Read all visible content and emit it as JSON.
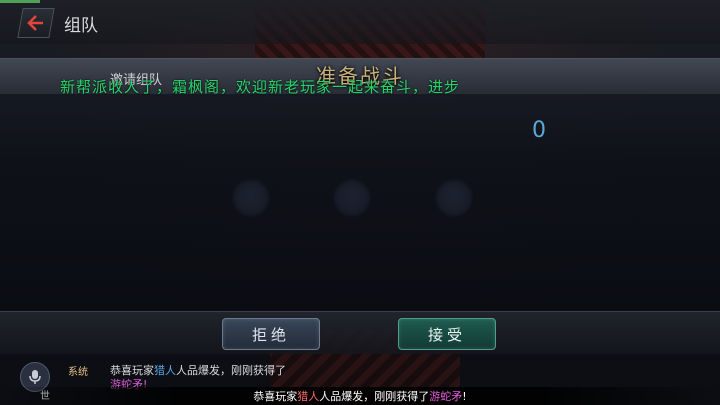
{
  "header": {
    "title": "组队"
  },
  "dialog": {
    "title": "准备战斗",
    "invite_label": "邀请组队",
    "countdown": "0",
    "marquee": "新帮派收人了，霜枫阁，欢迎新老玩家一起来奋斗，进步",
    "refuse_label": "拒绝",
    "accept_label": "接受"
  },
  "chat": {
    "channel": "系统",
    "line1_prefix": "恭喜玩家",
    "line1_player": "猎人",
    "line1_suffix": "人品爆发，刚刚获得了",
    "line2_item": "游蛇矛!",
    "world_label": "世"
  },
  "banner": {
    "prefix": "恭喜玩家",
    "player": "猎人",
    "middle": "人品爆发，刚刚获得了",
    "item": "游蛇矛",
    "suffix": "!"
  },
  "colors": {
    "marquee": "#27d46b",
    "countdown": "#5aa7d8",
    "accept": "#1f5b4f",
    "refuse": "#39465a",
    "item_highlight": "#e35ddc"
  },
  "icons": {
    "back": "back-arrow-icon",
    "mic": "microphone-icon"
  }
}
